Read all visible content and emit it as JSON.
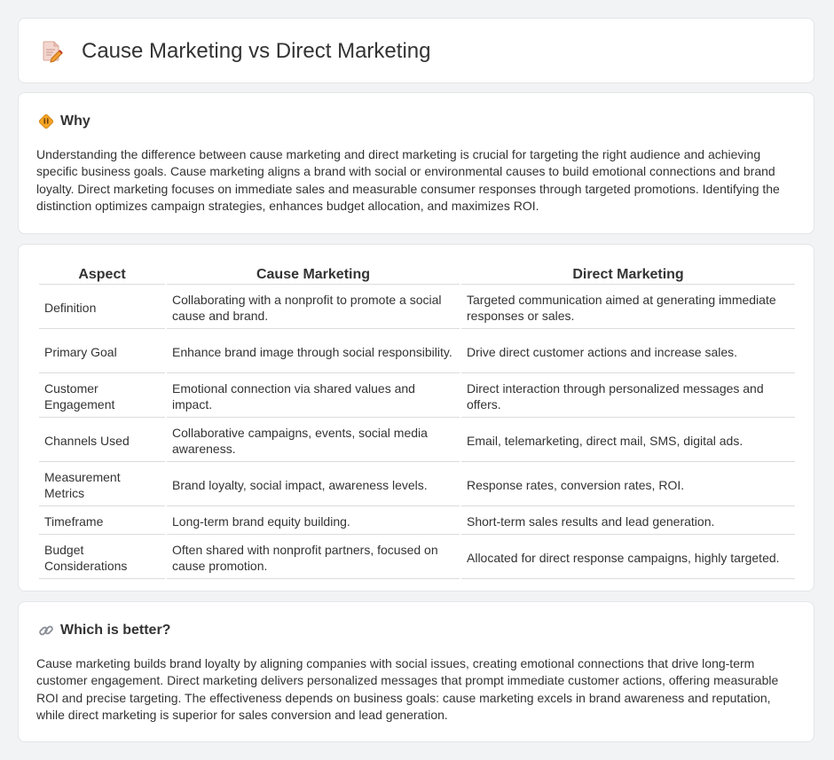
{
  "header": {
    "title": "Cause Marketing vs Direct Marketing",
    "icon": "document-pencil-icon"
  },
  "why": {
    "title": "Why",
    "icon": "diamond-sign-icon",
    "text": "Understanding the difference between cause marketing and direct marketing is crucial for targeting the right audience and achieving specific business goals. Cause marketing aligns a brand with social or environmental causes to build emotional connections and brand loyalty. Direct marketing focuses on immediate sales and measurable consumer responses through targeted promotions. Identifying the distinction optimizes campaign strategies, enhances budget allocation, and maximizes ROI."
  },
  "table": {
    "headers": [
      "Aspect",
      "Cause Marketing",
      "Direct Marketing"
    ],
    "rows": [
      [
        "Definition",
        "Collaborating with a nonprofit to promote a social cause and brand.",
        "Targeted communication aimed at generating immediate responses or sales."
      ],
      [
        "Primary Goal",
        "Enhance brand image through social responsibility.",
        "Drive direct customer actions and increase sales."
      ],
      [
        "Customer Engagement",
        "Emotional connection via shared values and impact.",
        "Direct interaction through personalized messages and offers."
      ],
      [
        "Channels Used",
        "Collaborative campaigns, events, social media awareness.",
        "Email, telemarketing, direct mail, SMS, digital ads."
      ],
      [
        "Measurement Metrics",
        "Brand loyalty, social impact, awareness levels.",
        "Response rates, conversion rates, ROI."
      ],
      [
        "Timeframe",
        "Long-term brand equity building.",
        "Short-term sales results and lead generation."
      ],
      [
        "Budget Considerations",
        "Often shared with nonprofit partners, focused on cause promotion.",
        "Allocated for direct response campaigns, highly targeted."
      ]
    ]
  },
  "better": {
    "title": "Which is better?",
    "icon": "link-icon",
    "text": "Cause marketing builds brand loyalty by aligning companies with social issues, creating emotional connections that drive long-term customer engagement. Direct marketing delivers personalized messages that prompt immediate customer actions, offering measurable ROI and precise targeting. The effectiveness depends on business goals: cause marketing excels in brand awareness and reputation, while direct marketing is superior for sales conversion and lead generation."
  },
  "colors": {
    "background": "#f2f3f5",
    "card": "#ffffff",
    "text": "#333333",
    "accent": "#f0a030"
  }
}
